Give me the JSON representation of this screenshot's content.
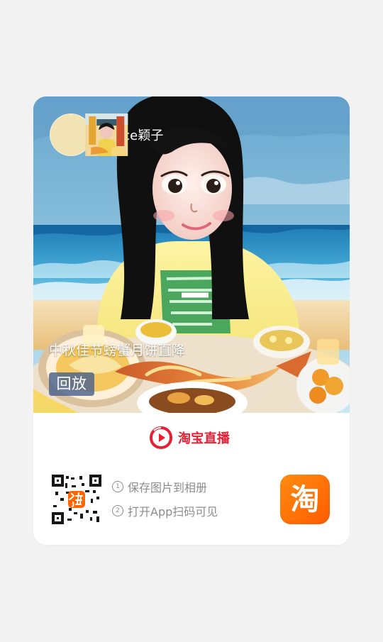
{
  "live_card": {
    "streamer_name": "grace颖子",
    "live_title": "中秋佳节螃蟹月饼直降",
    "replay_label": "回放"
  },
  "brand": {
    "name": "淘宝直播",
    "icon": "taobao-live-play-icon"
  },
  "instructions": {
    "steps": [
      {
        "number": "1",
        "text": "保存图片到相册"
      },
      {
        "number": "2",
        "text": "打开App扫码可见"
      }
    ]
  },
  "app_icon": {
    "label": "淘",
    "icon": "taobao-app-icon"
  },
  "colors": {
    "page_background": "#f2f2f3",
    "card_background": "#ffffff",
    "brand_red": "#ea1e32",
    "badge_background": "#4b618d",
    "app_orange": "#ff6a00",
    "muted_text": "#8c8c8c"
  }
}
